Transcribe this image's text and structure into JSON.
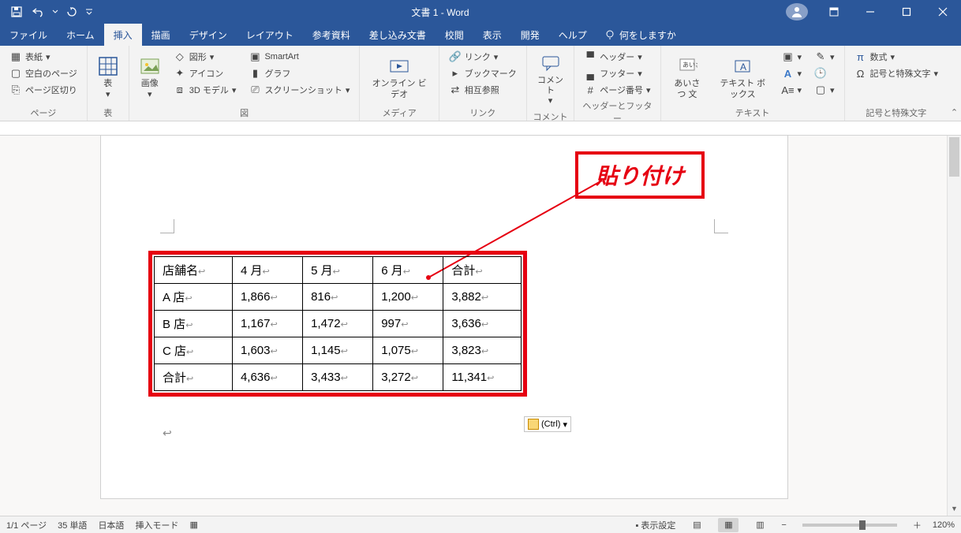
{
  "titlebar": {
    "title": "文書 1 - Word"
  },
  "tabs": [
    "ファイル",
    "ホーム",
    "挿入",
    "描画",
    "デザイン",
    "レイアウト",
    "参考資料",
    "差し込み文書",
    "校閲",
    "表示",
    "開発",
    "ヘルプ"
  ],
  "active_tab": "挿入",
  "tellme": "何をしますか",
  "ribbon": {
    "pages": {
      "label": "ページ",
      "cover": "表紙",
      "blank": "空白のページ",
      "break": "ページ区切り"
    },
    "tables": {
      "label": "表",
      "table": "表"
    },
    "illust": {
      "label": "図",
      "image": "画像",
      "shapes": "図形",
      "icons": "アイコン",
      "model3d": "3D モデル",
      "smartart": "SmartArt",
      "chart": "グラフ",
      "screenshot": "スクリーンショット"
    },
    "media": {
      "label": "メディア",
      "video": "オンライン ビデオ"
    },
    "links": {
      "label": "リンク",
      "link": "リンク",
      "bookmark": "ブックマーク",
      "crossref": "相互参照"
    },
    "comments": {
      "label": "コメント",
      "comment": "コメント"
    },
    "hf": {
      "label": "ヘッダーとフッター",
      "header": "ヘッダー",
      "footer": "フッター",
      "pagenum": "ページ番号"
    },
    "text": {
      "label": "テキスト",
      "greeting": "あいさつ 文",
      "textbox": "テキスト ボックス"
    },
    "symbols": {
      "label": "記号と特殊文字",
      "equation": "数式",
      "symbol": "記号と特殊文字"
    }
  },
  "annotation": "貼り付け",
  "table": {
    "headers": [
      "店舗名",
      "4 月",
      "5 月",
      "6 月",
      "合計"
    ],
    "rows": [
      [
        "A 店",
        "1,866",
        "816",
        "1,200",
        "3,882"
      ],
      [
        "B 店",
        "1,167",
        "1,472",
        "997",
        "3,636"
      ],
      [
        "C 店",
        "1,603",
        "1,145",
        "1,075",
        "3,823"
      ],
      [
        "合計",
        "4,636",
        "3,433",
        "3,272",
        "11,341"
      ]
    ]
  },
  "paste_opt": "(Ctrl)",
  "status": {
    "page": "1/1 ページ",
    "words": "35 単語",
    "lang": "日本語",
    "mode": "挿入モード",
    "display": "表示設定",
    "zoom": "120%"
  }
}
